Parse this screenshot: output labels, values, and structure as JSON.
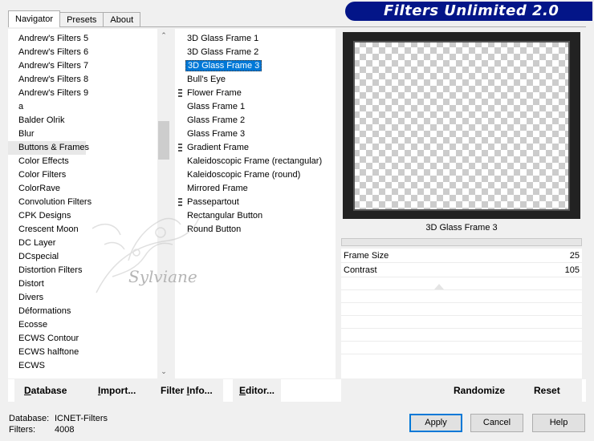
{
  "tabs": [
    {
      "label": "Navigator",
      "active": true
    },
    {
      "label": "Presets",
      "active": false
    },
    {
      "label": "About",
      "active": false
    }
  ],
  "banner": {
    "title": "Filters Unlimited 2.0",
    "color": "#031588"
  },
  "categories": [
    {
      "label": "Andrew's Filters 5"
    },
    {
      "label": "Andrew's Filters 6"
    },
    {
      "label": "Andrew's Filters 7"
    },
    {
      "label": "Andrew's Filters 8"
    },
    {
      "label": "Andrew's Filters 9"
    },
    {
      "label": "a"
    },
    {
      "label": "Balder Olrik"
    },
    {
      "label": "Blur"
    },
    {
      "label": "Buttons & Frames",
      "selected": true
    },
    {
      "label": "Color Effects"
    },
    {
      "label": "Color Filters"
    },
    {
      "label": "ColorRave"
    },
    {
      "label": "Convolution Filters"
    },
    {
      "label": "CPK Designs"
    },
    {
      "label": "Crescent Moon"
    },
    {
      "label": "DC Layer"
    },
    {
      "label": "DCspecial"
    },
    {
      "label": "Distortion Filters"
    },
    {
      "label": "Distort"
    },
    {
      "label": "Divers"
    },
    {
      "label": "Déformations"
    },
    {
      "label": "Ecosse"
    },
    {
      "label": "ECWS Contour"
    },
    {
      "label": "ECWS halftone"
    },
    {
      "label": "ECWS"
    }
  ],
  "filters": [
    {
      "label": "3D Glass Frame 1"
    },
    {
      "label": "3D Glass Frame 2"
    },
    {
      "label": "3D Glass Frame 3",
      "selected": true
    },
    {
      "label": "Bull's Eye"
    },
    {
      "label": "Flower Frame",
      "marker": true
    },
    {
      "label": "Glass Frame 1"
    },
    {
      "label": "Glass Frame 2"
    },
    {
      "label": "Glass Frame 3"
    },
    {
      "label": "Gradient Frame",
      "marker": true
    },
    {
      "label": "Kaleidoscopic Frame (rectangular)"
    },
    {
      "label": "Kaleidoscopic Frame (round)"
    },
    {
      "label": "Mirrored Frame"
    },
    {
      "label": "Passepartout",
      "marker": true
    },
    {
      "label": "Rectangular Button"
    },
    {
      "label": "Round Button"
    }
  ],
  "watermark": {
    "text": "Sylviane"
  },
  "preview": {
    "label": "3D Glass Frame 3"
  },
  "params": [
    {
      "name": "Frame Size",
      "value": "25"
    },
    {
      "name": "Contrast",
      "value": "105"
    }
  ],
  "bottom": {
    "database": {
      "ul": "D",
      "rest": "atabase"
    },
    "import": {
      "ul": "I",
      "rest": "mport..."
    },
    "filter_info": {
      "pre": "Filter ",
      "ul": "I",
      "rest": "nfo..."
    },
    "editor": {
      "ul": "E",
      "rest": "ditor..."
    },
    "randomize": "Randomize",
    "reset": "Reset"
  },
  "status": {
    "database_label": "Database:",
    "database_value": "ICNET-Filters",
    "filters_label": "Filters:",
    "filters_value": "4008"
  },
  "buttons": {
    "apply": "Apply",
    "cancel": "Cancel",
    "help": "Help"
  },
  "icons": {
    "scroll_up": "chevron-up-icon",
    "scroll_down": "chevron-down-icon",
    "marker": "submenu-marker-icon"
  }
}
